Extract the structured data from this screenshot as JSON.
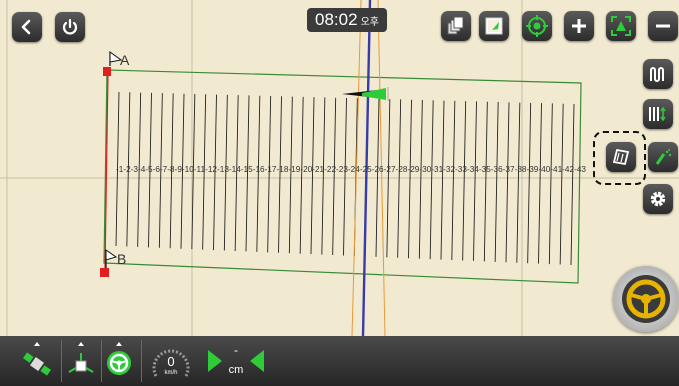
{
  "header": {
    "time": "08:02",
    "ampm": "오후"
  },
  "map": {
    "point_a_label": "A",
    "point_b_label": "B",
    "swath_numbers": "-1-2-3-4-5-6-7-8-9-10-11-12-13-14-15-16-17-18-19-20-21-22-23-24-25-26-27-28-29-30-31-32-33-34-35-36-37-38-39-40-41-42-43"
  },
  "bottom_bar": {
    "speed_value": "0",
    "speed_unit": "km/h",
    "cross_track_value": "-",
    "cross_track_unit": "cm"
  },
  "colors": {
    "map_background": "#f1ead0",
    "field_boundary": "#3a8a35",
    "guidance_line": "#3a3aa8",
    "accent_green": "#2ecc3a",
    "steering_yellow": "#e6b400",
    "point_red": "#e02020"
  },
  "icons": {
    "top_left": [
      "back-icon",
      "power-icon"
    ],
    "top_right": [
      "layers-icon",
      "map-view-icon",
      "gps-target-icon",
      "zoom-in-icon",
      "fit-field-icon",
      "zoom-out-icon"
    ],
    "right_column": [
      "swath-pattern-icon",
      "swath-shift-icon",
      "boundary-icon",
      "spray-icon",
      "settings-icon"
    ],
    "bottom": [
      "satellite-icon",
      "tractor-icon",
      "steering-wheel-icon"
    ]
  }
}
